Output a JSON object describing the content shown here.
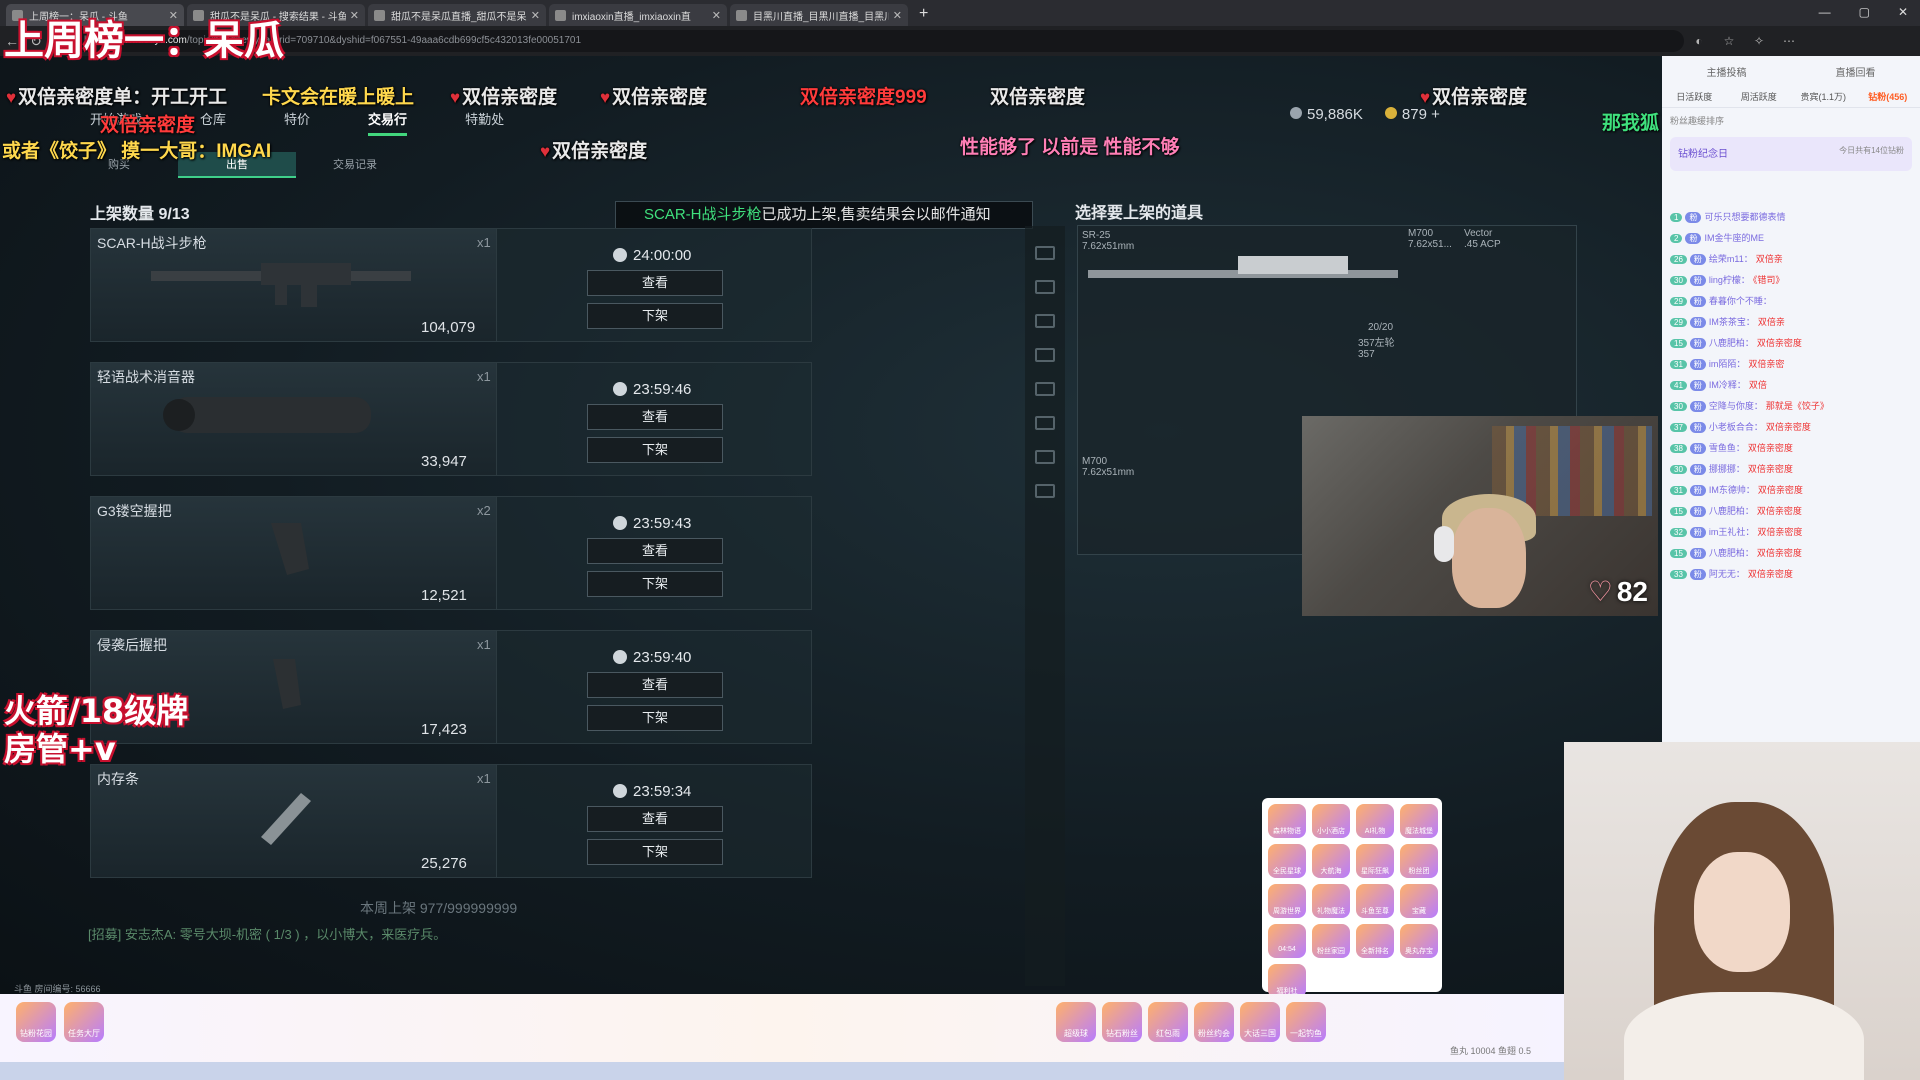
{
  "browser": {
    "tabs": [
      {
        "title": "上周榜一：呆瓜 - 斗鱼"
      },
      {
        "title": "甜瓜不是呆瓜 - 搜索结果 - 斗鱼"
      },
      {
        "title": "甜瓜不是呆瓜直播_甜瓜不是呆瓜"
      },
      {
        "title": "imxiaoxin直播_imxiaoxin直"
      },
      {
        "title": "目黑川直播_目黑川直播_目黑川"
      }
    ],
    "url_host": "www.douyu.com",
    "url_path": "/topic/pubgnewyear?rid=709710&dyshid=f067551-49aaa6cdb699cf5c432013fe00051701",
    "url_prefix": "https://"
  },
  "overlay": {
    "top_left": "上周榜一：呆瓜",
    "left_mid_line1": "火箭/18级牌",
    "left_mid_line2": "房管+v"
  },
  "danmu": [
    "双倍亲密度单：开工开工",
    "卡文会在暖上暖上",
    "双倍亲密度",
    "双倍亲密度",
    "双倍亲密度999",
    "双倍亲密度",
    "双倍亲密度",
    "双倍亲密度",
    "或者《饺子》 摸一大哥：IMGAI",
    "双倍亲密度",
    "性能够了 以前是 性能不够",
    "那我狐"
  ],
  "game": {
    "top_nav": [
      "开始游戏",
      "仓库",
      "特价",
      "交易行",
      "特勤处"
    ],
    "top_nav_active": "交易行",
    "currency": {
      "coins": "59,886K",
      "gold": "879 +"
    },
    "sub_tabs": [
      "购买",
      "出售",
      "交易记录"
    ],
    "sub_tab_active": "出售",
    "shelf_title": "上架数量 9/13",
    "toast_item": "SCAR-H战斗步枪",
    "toast_text": "已成功上架,售卖结果会以邮件通知",
    "choose_title": "选择要上架的道具",
    "view_label": "查看",
    "remove_label": "下架",
    "listings": [
      {
        "name": "SCAR-H战斗步枪",
        "qty": "x1",
        "price": "104,079",
        "timer": "24:00:00"
      },
      {
        "name": "轻语战术消音器",
        "qty": "x1",
        "price": "33,947",
        "timer": "23:59:46"
      },
      {
        "name": "G3镂空握把",
        "qty": "x2",
        "price": "12,521",
        "timer": "23:59:43"
      },
      {
        "name": "侵袭后握把",
        "qty": "x1",
        "price": "17,423",
        "timer": "23:59:40"
      },
      {
        "name": "内存条",
        "qty": "x1",
        "price": "25,276",
        "timer": "23:59:34"
      }
    ],
    "weekly": "本周上架 977/999999999",
    "recruit": "[招募] 安志杰A: 零号大坝-机密 ( 1/3 ) ，以小博大，来医疗兵。",
    "room_id": "斗鱼 房间编号: 56666",
    "grid_labels": {
      "sr25": "SR-25\n7.62x51mm",
      "m700": "M700\n7.62x51...",
      "vector": "Vector\n.45 ACP",
      "ammo": "20/20",
      "round": "357左轮\n357",
      "m700b": "M700\n7.62x51mm"
    }
  },
  "cam": {
    "likes": "82"
  },
  "sidebar": {
    "top_links": [
      "主播投稿",
      "直播回看"
    ],
    "tabs": [
      "日活跃度",
      "周活跃度",
      "贵宾(1.1万)",
      "钻粉(456)"
    ],
    "fans_note": "粉丝趣缓排序",
    "day_title": "钻粉纪念日",
    "day_note": "今日共有14位钻粉",
    "chat": [
      {
        "lvl": "1",
        "user": "可乐只想要都德表情",
        "msg": ""
      },
      {
        "lvl": "2",
        "user": "IM金牛座的ME",
        "msg": ""
      },
      {
        "lvl": "26",
        "user": "绘荣m11：",
        "msg": "双倍亲"
      },
      {
        "lvl": "30",
        "user": "ling柠檬：",
        "msg": "《错司》"
      },
      {
        "lvl": "29",
        "user": "春暮你个不睡：",
        "msg": ""
      },
      {
        "lvl": "29",
        "user": "IM茶茶宝：",
        "msg": "双倍亲"
      },
      {
        "lvl": "15",
        "user": "八鹿肥柏：",
        "msg": "双倍亲密度"
      },
      {
        "lvl": "31",
        "user": "im陌陌：",
        "msg": "双倍亲密"
      },
      {
        "lvl": "41",
        "user": "IM冷释：",
        "msg": "双倍"
      },
      {
        "lvl": "30",
        "user": "空降与你度：",
        "msg": "那就是《饺子》"
      },
      {
        "lvl": "37",
        "user": "小老板合合：",
        "msg": "双倍亲密度"
      },
      {
        "lvl": "38",
        "user": "雪鱼鱼：",
        "msg": "双倍亲密度"
      },
      {
        "lvl": "30",
        "user": "挪挪挪：",
        "msg": "双倍亲密度"
      },
      {
        "lvl": "31",
        "user": "IM东德帅：",
        "msg": "双倍亲密度"
      },
      {
        "lvl": "15",
        "user": "八鹿肥柏：",
        "msg": "双倍亲密度"
      },
      {
        "lvl": "32",
        "user": "im王礼社：",
        "msg": "双倍亲密度"
      },
      {
        "lvl": "15",
        "user": "八鹿肥柏：",
        "msg": "双倍亲密度"
      },
      {
        "lvl": "33",
        "user": "阿无无：",
        "msg": "双倍亲密度"
      }
    ]
  },
  "giftbar": {
    "left": [
      "钻粉花园",
      "任务大厅"
    ],
    "right": [
      "超级球",
      "钻石粉丝",
      "红包雨",
      "粉丝约会",
      "大话三国",
      "一起钓鱼"
    ],
    "popup": [
      "森林物语",
      "小小酒店",
      "AI礼物",
      "魔法城堡",
      "全民星球",
      "大航海",
      "星际狂飙",
      "粉丝团",
      "周游世界",
      "礼物魔法",
      "斗鱼至尊",
      "宝藏",
      "04:54",
      "粉丝家园",
      "全新排名",
      "奥丸存宝",
      "福利社"
    ],
    "footer": "鱼丸 10004  鱼翅 0.5"
  }
}
